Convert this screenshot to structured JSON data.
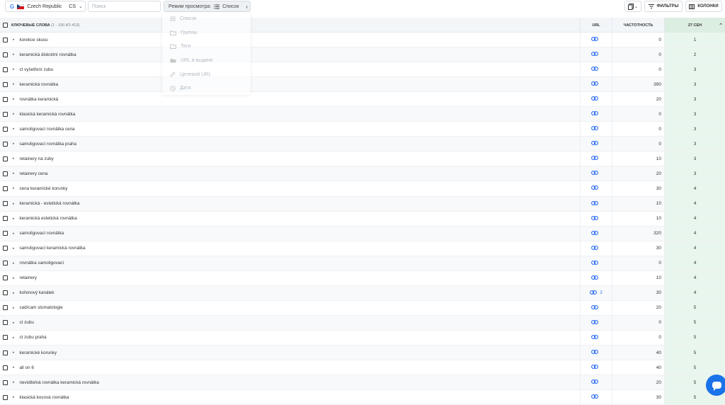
{
  "toolbar": {
    "region": {
      "engine": "G",
      "country": "Czech Republic",
      "lang": "CS"
    },
    "search": {
      "placeholder": "Поиск"
    },
    "view_mode": {
      "label": "Режим просмотра:",
      "value": "Список"
    },
    "filters_label": "ФИЛЬТРЫ",
    "columns_label": "КОЛОНКИ"
  },
  "view_menu": {
    "items": [
      {
        "label": "Список",
        "icon": "list-icon"
      },
      {
        "label": "Группы",
        "icon": "folder-icon"
      },
      {
        "label": "Теги",
        "icon": "folder-icon"
      },
      {
        "label": "URL в выдаче",
        "icon": "folder-filled-icon"
      },
      {
        "label": "Целевой URL",
        "icon": "link-icon"
      },
      {
        "label": "Дата",
        "icon": "clock-icon"
      }
    ]
  },
  "table": {
    "header": {
      "keywords": "КЛЮЧЕВЫЕ СЛОВА",
      "count": "(1 - 100 ИЗ 413)",
      "url": "URL",
      "frequency": "ЧАСТОТНОСТЬ",
      "date": "27 СЕН"
    },
    "rows": [
      {
        "kw": "korekce skusu",
        "url_count": "",
        "freq": "0",
        "pos": "1"
      },
      {
        "kw": "keramická diskrétní rovnátka",
        "url_count": "",
        "freq": "0",
        "pos": "2"
      },
      {
        "kw": "ct vyšetření zubu",
        "url_count": "",
        "freq": "0",
        "pos": "3"
      },
      {
        "kw": "keramická rovnátka",
        "url_count": "",
        "freq": "390",
        "pos": "3"
      },
      {
        "kw": "rovnátka keramická",
        "url_count": "",
        "freq": "20",
        "pos": "3"
      },
      {
        "kw": "klasická keramická rovnátka",
        "url_count": "",
        "freq": "0",
        "pos": "3"
      },
      {
        "kw": "samoligovací rovnátka cena",
        "url_count": "",
        "freq": "0",
        "pos": "3"
      },
      {
        "kw": "samoligovací rovnátka praha",
        "url_count": "",
        "freq": "0",
        "pos": "3"
      },
      {
        "kw": "retainery na zuby",
        "url_count": "",
        "freq": "10",
        "pos": "3"
      },
      {
        "kw": "retainery cena",
        "url_count": "",
        "freq": "20",
        "pos": "3"
      },
      {
        "kw": "cena keramické korunky",
        "url_count": "",
        "freq": "30",
        "pos": "4"
      },
      {
        "kw": "keramická - estetická rovnátka",
        "url_count": "",
        "freq": "10",
        "pos": "4"
      },
      {
        "kw": "keramická estetická rovnátka",
        "url_count": "",
        "freq": "10",
        "pos": "4"
      },
      {
        "kw": "samoligovací rovnátka",
        "url_count": "",
        "freq": "320",
        "pos": "4"
      },
      {
        "kw": "samoligovací keramická rovnátka",
        "url_count": "",
        "freq": "30",
        "pos": "4"
      },
      {
        "kw": "rovnátka samoligovací",
        "url_count": "",
        "freq": "0",
        "pos": "4"
      },
      {
        "kw": "retainery",
        "url_count": "",
        "freq": "10",
        "pos": "4"
      },
      {
        "kw": "kořenový kanálek",
        "url_count": "2",
        "freq": "30",
        "pos": "4"
      },
      {
        "kw": "cad/cam stomatologie",
        "url_count": "",
        "freq": "20",
        "pos": "5"
      },
      {
        "kw": "ct zubu",
        "url_count": "",
        "freq": "0",
        "pos": "5"
      },
      {
        "kw": "ct zubu praha",
        "url_count": "",
        "freq": "0",
        "pos": "5"
      },
      {
        "kw": "keramické korunky",
        "url_count": "",
        "freq": "40",
        "pos": "5"
      },
      {
        "kw": "all on 6",
        "url_count": "",
        "freq": "40",
        "pos": "5"
      },
      {
        "kw": "neviditelná rovnátka keramická rovnátka",
        "url_count": "",
        "freq": "20",
        "pos": "5"
      },
      {
        "kw": "klasická kovová rovnátka",
        "url_count": "",
        "freq": "30",
        "pos": "5"
      }
    ]
  }
}
